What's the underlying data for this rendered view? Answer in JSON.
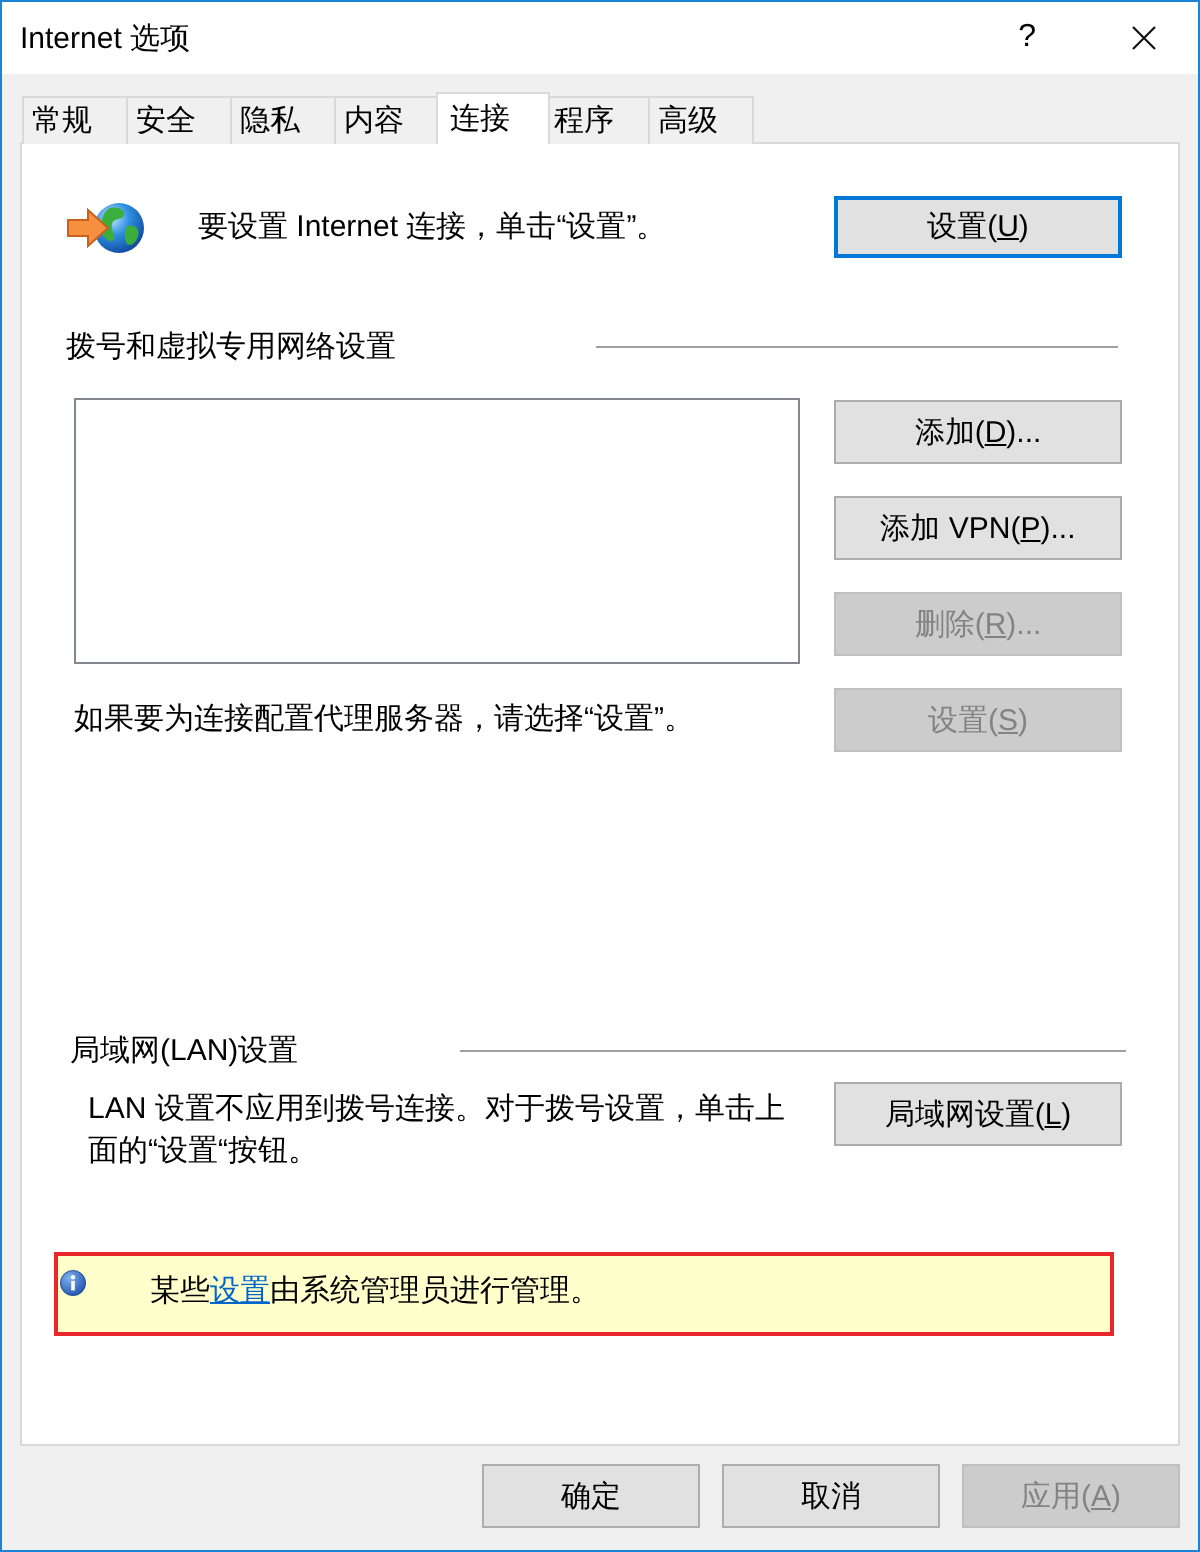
{
  "window": {
    "title": "Internet 选项",
    "help_button": "?"
  },
  "tabs": [
    {
      "label": "常规",
      "selected": false
    },
    {
      "label": "安全",
      "selected": false
    },
    {
      "label": "隐私",
      "selected": false
    },
    {
      "label": "内容",
      "selected": false
    },
    {
      "label": "连接",
      "selected": true
    },
    {
      "label": "程序",
      "selected": false
    },
    {
      "label": "高级",
      "selected": false
    }
  ],
  "setup": {
    "text": "要设置 Internet 连接，单击“设置”。",
    "button": {
      "text": "设置(",
      "access_key": "U",
      "text_end": ")",
      "disabled": false,
      "focused": true
    }
  },
  "dialup": {
    "heading": "拨号和虚拟专用网络设置",
    "buttons": [
      {
        "text": "添加(",
        "access_key": "D",
        "text_end": ")...",
        "disabled": false,
        "focused": false
      },
      {
        "text": "添加 VPN(",
        "access_key": "P",
        "text_end": ")...",
        "disabled": false,
        "focused": false
      },
      {
        "text": "删除(",
        "access_key": "R",
        "text_end": ")...",
        "disabled": true,
        "focused": false
      },
      {
        "text": "设置(",
        "access_key": "S",
        "text_end": ")",
        "disabled": true,
        "focused": false
      }
    ],
    "proxy_hint": "如果要为连接配置代理服务器，请选择“设置”。"
  },
  "lan": {
    "heading": "局域网(LAN)设置",
    "text": "LAN 设置不应用到拨号连接。对于拨号设置，单击上面的“设置“按钮。",
    "button": {
      "text": "局域网设置(",
      "access_key": "L",
      "text_end": ")",
      "disabled": false,
      "focused": false
    }
  },
  "notice": {
    "text_before": "某些",
    "link": "设置",
    "text_after": "由系统管理员进行管理。"
  },
  "footer_buttons": [
    {
      "text": "确定",
      "disabled": false,
      "focused": false
    },
    {
      "text": "取消",
      "disabled": false,
      "focused": false
    },
    {
      "text": "应用(",
      "access_key": "A",
      "text_end": ")",
      "disabled": true,
      "focused": false
    }
  ]
}
